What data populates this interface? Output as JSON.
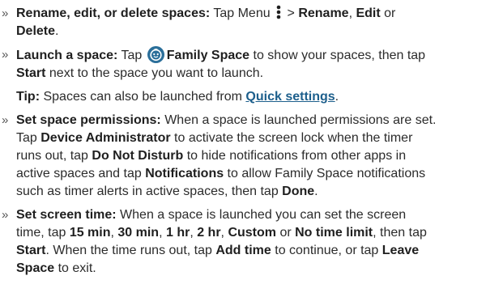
{
  "bullet_glyph": "»",
  "icons": {
    "menu": "vertical-dots-icon",
    "family_space": "family-space-app-icon",
    "family_space_color": "#2b6f9a"
  },
  "link_color": "#1d5f8c",
  "items": {
    "rename": {
      "title": "Rename, edit, or delete spaces:",
      "t1": " Tap Menu ",
      "t2": " > ",
      "b1": "Rename",
      "t3": ", ",
      "b2": "Edit",
      "t4": " or",
      "b3": "Delete",
      "t5": "."
    },
    "launch": {
      "title": "Launch a space:",
      "t1": " Tap ",
      "b1": "Family Space",
      "t2": " to show your spaces, then tap",
      "b2": "Start",
      "t3": " next to the space you want to launch."
    },
    "tip": {
      "title": "Tip:",
      "t1": " Spaces can also be launched from ",
      "link": "Quick settings",
      "t2": "."
    },
    "permissions": {
      "title": "Set space permissions:",
      "t1": " When a space is launched permissions are set.",
      "t2": "Tap ",
      "b1": "Device Administrator",
      "t3": " to activate the screen lock when the timer",
      "t4": "runs out, tap ",
      "b2": "Do Not Disturb",
      "t5": " to hide notifications from other apps in",
      "t6": "active spaces and tap ",
      "b3": "Notifications",
      "t7": " to allow Family Space notifications",
      "t8": "such as timer alerts in active spaces, then tap ",
      "b4": "Done",
      "t9": "."
    },
    "screen_time": {
      "title": "Set screen time:",
      "t1": " When a space is launched you can set the screen",
      "t2": "time, tap ",
      "b1": "15 min",
      "t3": ", ",
      "b2": "30 min",
      "t4": ", ",
      "b3": "1 hr",
      "t5": ", ",
      "b4": "2 hr",
      "t6": ", ",
      "b5": "Custom",
      "t7": " or ",
      "b6": "No time limit",
      "t8": ", then tap",
      "b7": "Start",
      "t9": ". When the time runs out, tap ",
      "b8": "Add time",
      "t10": " to continue, or tap ",
      "b9": "Leave",
      "b10": "Space",
      "t11": " to exit."
    }
  }
}
